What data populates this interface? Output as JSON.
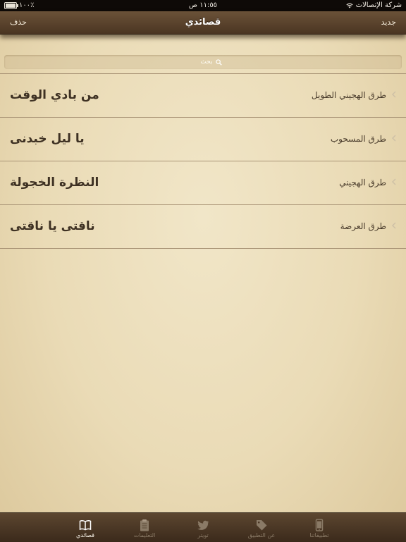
{
  "status_bar": {
    "battery": "١٠٠٪",
    "time": "١١:٥٥ ص",
    "carrier": "شركة الإتصالات"
  },
  "nav": {
    "title": "قصائدي",
    "left_button": "حذف",
    "right_button": "جديد"
  },
  "search": {
    "placeholder": "بحث"
  },
  "list": [
    {
      "title": "من بادي الوقت",
      "subtitle": "طرق الهجيني الطويل"
    },
    {
      "title": "يا ليل خبدنى",
      "subtitle": "طرق المسحوب"
    },
    {
      "title": "النظرة الخجولة",
      "subtitle": "طرق الهجيني"
    },
    {
      "title": "ناقتى يا ناقتى",
      "subtitle": "طرق العرضة"
    }
  ],
  "tabs": [
    {
      "label": "قصائدي",
      "icon": "book-icon",
      "active": true
    },
    {
      "label": "التعليمات",
      "icon": "clipboard-icon",
      "active": false
    },
    {
      "label": "تويتر",
      "icon": "twitter-bird-icon",
      "active": false
    },
    {
      "label": "عن التطبيق",
      "icon": "tag-icon",
      "active": false
    },
    {
      "label": "تطبيقاتنا",
      "icon": "phone-icon",
      "active": false
    }
  ],
  "colors": {
    "nav_bar": "#5b4430",
    "paper": "#eadbb6",
    "row_title": "#3e3123",
    "divider": "#a99476"
  }
}
